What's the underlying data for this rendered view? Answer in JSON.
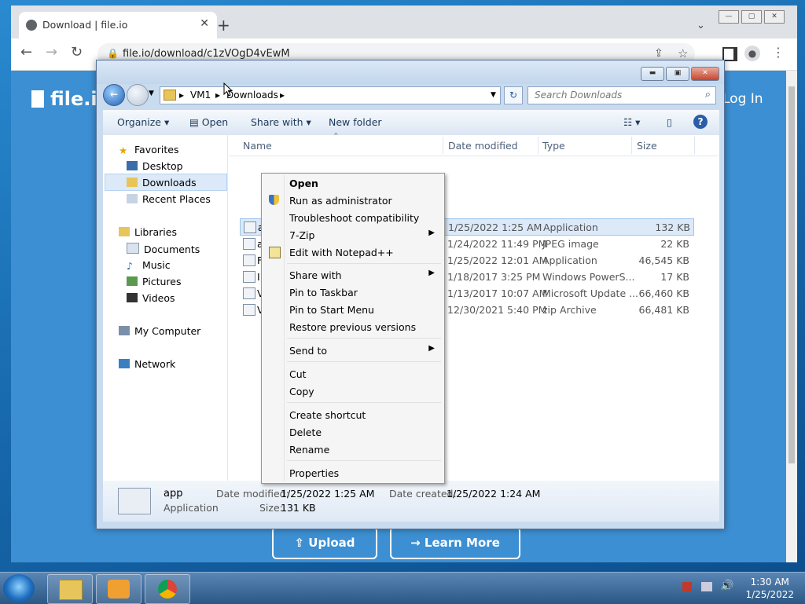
{
  "browser": {
    "tab_title": "Download | file.io",
    "url": "file.io/download/c1zVOgD4vEwM",
    "site_logo": "file.io",
    "login": "Log In",
    "upload_button": "Upload",
    "learn_more_button": "Learn More"
  },
  "explorer": {
    "breadcrumb": [
      "VM1",
      "Downloads"
    ],
    "search_placeholder": "Search Downloads",
    "commands": {
      "organize": "Organize",
      "open": "Open",
      "share_with": "Share with",
      "new_folder": "New folder"
    },
    "nav": {
      "favorites": "Favorites",
      "desktop": "Desktop",
      "downloads": "Downloads",
      "recent": "Recent Places",
      "libraries": "Libraries",
      "documents": "Documents",
      "music": "Music",
      "pictures": "Pictures",
      "videos": "Videos",
      "computer": "My Computer",
      "network": "Network"
    },
    "columns": {
      "name": "Name",
      "date": "Date modified",
      "type": "Type",
      "size": "Size"
    },
    "files": [
      {
        "name": "app",
        "date": "1/25/2022 1:25 AM",
        "type": "Application",
        "size": "132 KB"
      },
      {
        "name": "a",
        "date": "1/24/2022 11:49 PM",
        "type": "JPEG image",
        "size": "22 KB"
      },
      {
        "name": "F",
        "date": "1/25/2022 12:01 AM",
        "type": "Application",
        "size": "46,545 KB"
      },
      {
        "name": "I",
        "date": "1/18/2017 3:25 PM",
        "type": "Windows PowerS...",
        "size": "17 KB"
      },
      {
        "name": "V",
        "date": "1/13/2017 10:07 AM",
        "type": "Microsoft Update ...",
        "size": "66,460 KB"
      },
      {
        "name": "V",
        "date": "12/30/2021 5:40 PM",
        "type": "zip Archive",
        "size": "66,481 KB"
      }
    ],
    "details": {
      "name": "app",
      "kind": "Application",
      "date_modified_label": "Date modified:",
      "date_modified": "1/25/2022 1:25 AM",
      "date_created_label": "Date created:",
      "date_created": "1/25/2022 1:24 AM",
      "size_label": "Size:",
      "size": "131 KB"
    }
  },
  "context_menu": {
    "open": "Open",
    "run_admin": "Run as administrator",
    "troubleshoot": "Troubleshoot compatibility",
    "zip": "7-Zip",
    "notepad": "Edit with Notepad++",
    "share_with": "Share with",
    "pin_taskbar": "Pin to Taskbar",
    "pin_start": "Pin to Start Menu",
    "restore": "Restore previous versions",
    "send_to": "Send to",
    "cut": "Cut",
    "copy": "Copy",
    "create_shortcut": "Create shortcut",
    "delete": "Delete",
    "rename": "Rename",
    "properties": "Properties"
  },
  "taskbar": {
    "time": "1:30 AM",
    "date": "1/25/2022"
  }
}
